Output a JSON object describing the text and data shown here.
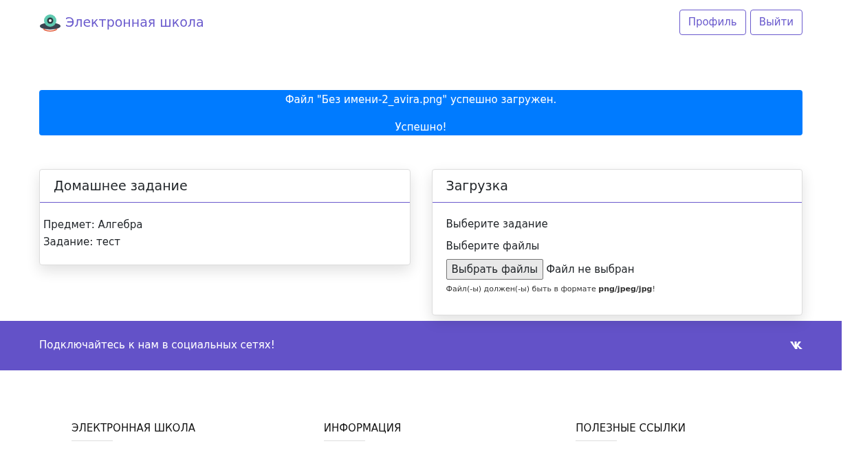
{
  "navbar": {
    "brand": "Электронная школа",
    "buttons": [
      "Профиль",
      "Выйти"
    ]
  },
  "alert": {
    "lines": [
      "Файл \"Без имени-2_avira.png\" успешно загружен.",
      "Успешно!"
    ]
  },
  "homework": {
    "title": "Домашнее задание",
    "lines": [
      "Предмет: Алгебра",
      "Задание: тест"
    ]
  },
  "upload": {
    "title": "Загрузка",
    "task_label": "Выберите задание",
    "files_label": "Выберите файлы",
    "file_button": "Выбрать файлы",
    "file_status": "Файл не выбран",
    "hint": "Файл(-ы) должен(-ы) быть в формате **png/jpeg/jpg**!"
  },
  "social": {
    "text": "Подключайтесь к нам в социальных сетях!"
  },
  "footer": {
    "columns": [
      "ЭЛЕКТРОННАЯ ШКОЛА",
      "ИНФОРМАЦИЯ",
      "ПОЛЕЗНЫЕ ССЫЛКИ"
    ]
  }
}
